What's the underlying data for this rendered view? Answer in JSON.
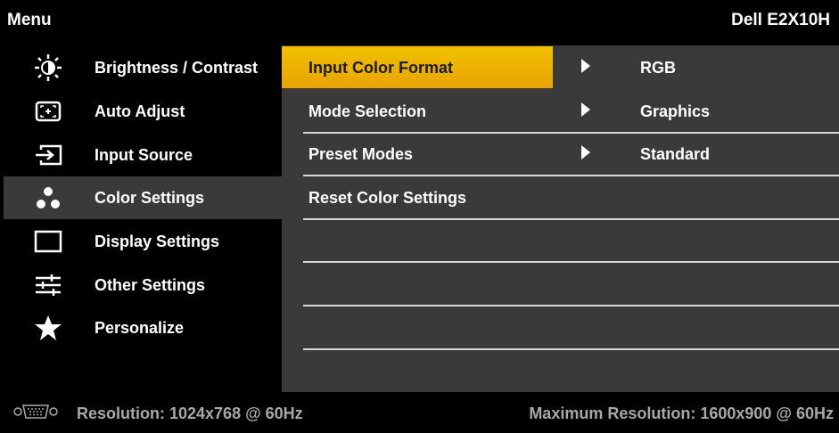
{
  "header": {
    "title": "Menu",
    "model": "Dell E2X10H"
  },
  "sidebar": {
    "items": [
      {
        "label": "Brightness / Contrast",
        "icon": "brightness-icon"
      },
      {
        "label": "Auto Adjust",
        "icon": "auto-adjust-icon"
      },
      {
        "label": "Input Source",
        "icon": "input-source-icon"
      },
      {
        "label": "Color Settings",
        "icon": "color-settings-icon",
        "active": true
      },
      {
        "label": "Display Settings",
        "icon": "display-settings-icon"
      },
      {
        "label": "Other Settings",
        "icon": "other-settings-icon"
      },
      {
        "label": "Personalize",
        "icon": "star-icon"
      }
    ]
  },
  "panel": {
    "rows": [
      {
        "label": "Input Color Format",
        "value": "RGB",
        "selected": true
      },
      {
        "label": "Mode Selection",
        "value": "Graphics"
      },
      {
        "label": "Preset Modes",
        "value": "Standard"
      },
      {
        "label": "Reset Color Settings",
        "value": ""
      }
    ]
  },
  "footer": {
    "resolution": "Resolution: 1024x768 @ 60Hz",
    "max_resolution": "Maximum Resolution: 1600x900 @ 60Hz",
    "icon": "vga-connector-icon"
  },
  "colors": {
    "highlight": "#f1c000",
    "panel_bg": "#3a3a3a",
    "text": "#ffffff",
    "footer_text": "#a8a8a8"
  }
}
